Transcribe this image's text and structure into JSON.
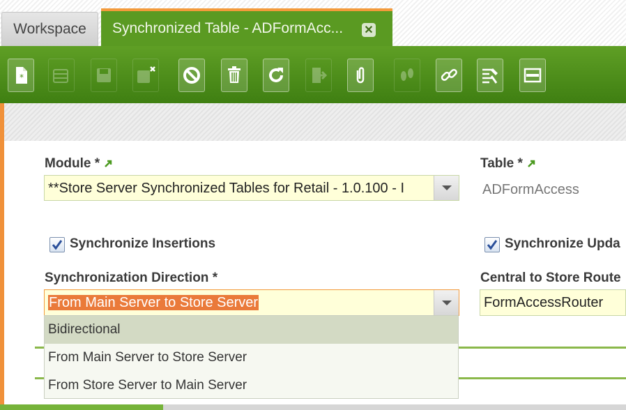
{
  "tabs": {
    "workspace_label": "Workspace",
    "active_label": "Synchronized Table - ADFormAcc...",
    "close_symbol": "✕"
  },
  "toolbar": {
    "buttons": [
      {
        "icon": "new-document-icon",
        "enabled": true
      },
      {
        "icon": "grid-view-icon",
        "enabled": false
      },
      {
        "icon": "save-icon",
        "enabled": false
      },
      {
        "icon": "save-close-icon",
        "enabled": false
      },
      {
        "icon": "undo-cancel-icon",
        "enabled": true
      },
      {
        "icon": "delete-icon",
        "enabled": true
      },
      {
        "icon": "refresh-icon",
        "enabled": true
      },
      {
        "icon": "export-icon",
        "enabled": false
      },
      {
        "icon": "attachment-icon",
        "enabled": true
      },
      {
        "icon": "audit-trail-icon",
        "enabled": false
      },
      {
        "icon": "link-icon",
        "enabled": true
      },
      {
        "icon": "tools-icon",
        "enabled": true
      },
      {
        "icon": "form-layout-icon",
        "enabled": true
      }
    ]
  },
  "form": {
    "module_label": "Module *",
    "module_value": "**Store Server Synchronized Tables for Retail - 1.0.100 - I",
    "table_label": "Table *",
    "table_value": "ADFormAccess",
    "sync_insertions_label": "Synchronize Insertions",
    "sync_insertions_checked": true,
    "sync_updates_label": "Synchronize Upda",
    "sync_updates_checked": true,
    "direction_label": "Synchronization Direction *",
    "direction_value": "From Main Server to Store Server",
    "router_label": "Central to Store Route",
    "router_value": "FormAccessRouter"
  },
  "dropdown": {
    "options": [
      {
        "label": "Bidirectional",
        "highlighted": true
      },
      {
        "label": "From Main Server to Store Server",
        "highlighted": false
      },
      {
        "label": "From Store Server to Main Server",
        "highlighted": false
      }
    ]
  },
  "colors": {
    "toolbar_green": "#4f8f1c",
    "tab_active_green": "#5a9a22",
    "accent_orange": "#f39a3b",
    "field_yellow": "#ffffd9",
    "selection_orange": "#ea7a3a"
  }
}
